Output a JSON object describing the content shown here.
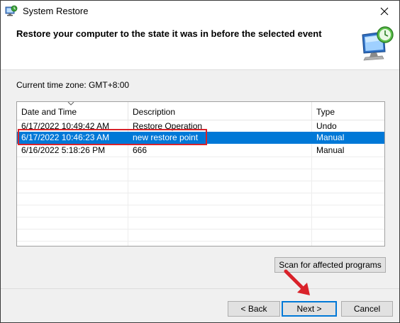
{
  "window": {
    "title": "System Restore",
    "icon": "system-restore-icon"
  },
  "header": {
    "heading": "Restore your computer to the state it was in before the selected event",
    "graphic": "computer-restore-clock-icon"
  },
  "timezone_label": "Current time zone: GMT+8:00",
  "restore_points": {
    "columns": [
      "Date and Time",
      "Description",
      "Type"
    ],
    "sort_column": "Date and Time",
    "rows": [
      {
        "date": "6/17/2022 10:49:42 AM",
        "description": "Restore Operation",
        "type": "Undo",
        "selected": false
      },
      {
        "date": "6/17/2022 10:46:23 AM",
        "description": "new restore point",
        "type": "Manual",
        "selected": true
      },
      {
        "date": "6/16/2022 5:18:26 PM",
        "description": "666",
        "type": "Manual",
        "selected": false
      }
    ]
  },
  "buttons": {
    "scan": "Scan for affected programs",
    "back": "< Back",
    "next": "Next >",
    "cancel": "Cancel"
  },
  "annotations": {
    "highlight_color": "#d9222a",
    "arrow_color": "#d9222a",
    "selection_color": "#0078d7"
  }
}
